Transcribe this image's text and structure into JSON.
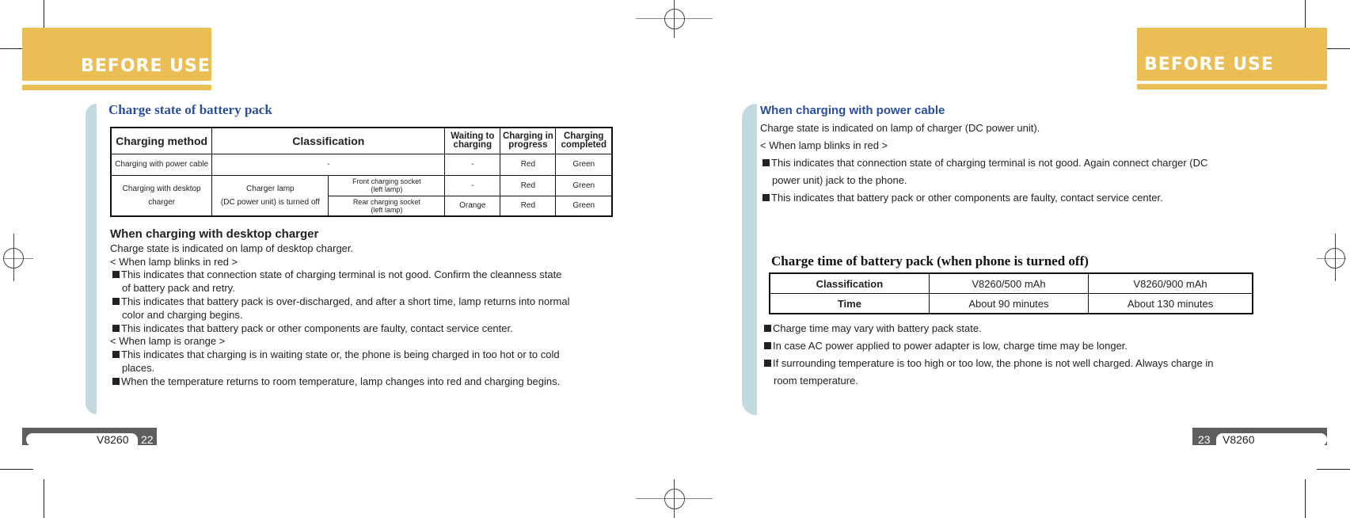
{
  "left_page": {
    "banner": "BEFORE USE",
    "section_title": "Charge state of battery pack",
    "table": {
      "headers": [
        "Charging method",
        "Classification",
        "Waiting to charging",
        "Charging in progress",
        "Charging completed"
      ],
      "rows": [
        {
          "method": "Charging with power cable",
          "classification": "-",
          "waiting": "-",
          "progress": "Red",
          "completed": "Green"
        },
        {
          "method": "Charging with desktop charger",
          "classification": "Charger lamp (DC power unit) is turned off",
          "sub": "Front charging socket (left lamp)",
          "waiting": "-",
          "progress": "Red",
          "completed": "Green"
        },
        {
          "sub": "Rear charging socket (left lamp)",
          "waiting": "Orange",
          "progress": "Red",
          "completed": "Green"
        }
      ],
      "method_2_line1": "Charging with desktop",
      "method_2_line2": "charger",
      "class_2_line1": "Charger lamp",
      "class_2_line2": "(DC power unit) is turned off",
      "sub_1_line1": "Front charging socket",
      "sub_1_line2": "(left lamp)",
      "sub_2_line1": "Rear charging socket",
      "sub_2_line2": "(left lamp)",
      "h_wait_1": "Waiting to",
      "h_wait_2": "charging",
      "h_prog_1": "Charging in",
      "h_prog_2": "progress",
      "h_comp_1": "Charging",
      "h_comp_2": "completed"
    },
    "desktop": {
      "heading": "When charging with desktop charger",
      "intro": "Charge state is indicated on lamp of desktop charger.",
      "red_label": "< When lamp blinks in red >",
      "red_items": [
        {
          "l1": "This indicates that connection state of charging  terminal is not good. Confirm the cleanness state",
          "l2": "of battery pack and retry."
        },
        {
          "l1": "This indicates that battery pack is over-discharged, and after a short time, lamp returns into normal",
          "l2": "color and charging begins."
        },
        {
          "l1": "This indicates that battery pack or other components are faulty, contact service center."
        }
      ],
      "orange_label": "< When lamp is orange >",
      "orange_items": [
        {
          "l1": "This indicates that charging is in waiting state or, the phone is being charged in too hot or to cold",
          "l2": "places."
        },
        {
          "l1": "When the temperature returns to room temperature, lamp changes into red and charging begins."
        }
      ]
    },
    "footer": {
      "model": "V8260",
      "page": "22"
    }
  },
  "right_page": {
    "banner": "BEFORE USE",
    "power": {
      "heading": "When charging with power cable",
      "intro": "Charge state is indicated on lamp of charger (DC power unit).",
      "red_label": "< When lamp blinks in red >",
      "items": [
        {
          "l1": "This indicates that connection  state of charging terminal is  not good. Again connect charger (DC",
          "l2": "power unit)  jack to the phone."
        },
        {
          "l1": "This indicates that battery pack or other components are faulty, contact service center."
        }
      ]
    },
    "time_title": "Charge time of battery pack (when phone is turned off)",
    "time_table": {
      "headers": [
        "Classification",
        "V8260/500 mAh",
        "V8260/900 mAh"
      ],
      "row": [
        "Time",
        "About 90 minutes",
        "About 130 minutes"
      ]
    },
    "notes": [
      {
        "l1": "Charge time may vary with battery pack state."
      },
      {
        "l1": "In case AC power applied to power adapter is low, charge time may be longer."
      },
      {
        "l1": "If surrounding  temperature is too  high or too  low, the  phone is not  well charged. Always charge in",
        "l2": "room temperature."
      }
    ],
    "footer": {
      "model": "V8260",
      "page": "23"
    }
  }
}
